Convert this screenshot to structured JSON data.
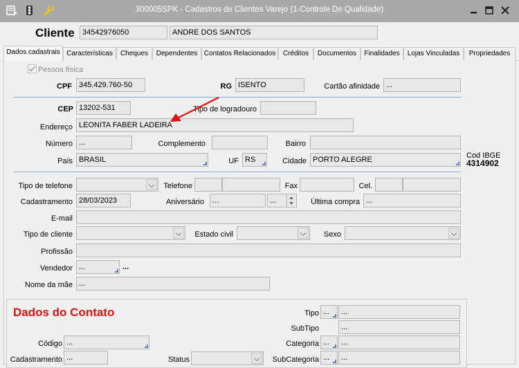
{
  "window": {
    "title": "300005SPK - Cadastros de Clientes Varejo (1-Controle De Qualidade)",
    "icons": [
      "menu-icon",
      "traffic-light-icon",
      "wrench-icon"
    ],
    "controls": [
      "minimize-icon",
      "restore-icon",
      "close-icon"
    ]
  },
  "header": {
    "label": "Cliente",
    "code": "34542976050",
    "name": "ANDRE DOS SANTOS"
  },
  "tabs": [
    {
      "label": "Dados cadastrais",
      "active": true
    },
    {
      "label": "Características"
    },
    {
      "label": "Cheques"
    },
    {
      "label": "Dependentes"
    },
    {
      "label": "Contatos Relacionados"
    },
    {
      "label": "Créditos"
    },
    {
      "label": "Documentos"
    },
    {
      "label": "Finalidades"
    },
    {
      "label": "Lojas Vinculadas"
    },
    {
      "label": "Propriedades"
    }
  ],
  "form": {
    "pessoa_fisica": {
      "label": "Pessoa física",
      "checked": true
    },
    "cpf": {
      "label": "CPF",
      "value": "345.429.760-50"
    },
    "rg": {
      "label": "RG",
      "value": "ISENTO"
    },
    "cartao_afinidade": {
      "label": "Cartão afinidade",
      "value": "..."
    },
    "cep": {
      "label": "CEP",
      "value": "13202-531"
    },
    "tipo_logradouro": {
      "label": "Tipo de logradouro",
      "value": ""
    },
    "endereco": {
      "label": "Endereço",
      "value": "LEONITA FABER LADEIRA"
    },
    "numero": {
      "label": "Número",
      "value": "..."
    },
    "complemento": {
      "label": "Complemento",
      "value": ""
    },
    "bairro": {
      "label": "Bairro",
      "value": ""
    },
    "pais": {
      "label": "País",
      "value": "BRASIL"
    },
    "uf": {
      "label": "UF",
      "value": "RS"
    },
    "cidade": {
      "label": "Cidade",
      "value": "PORTO ALEGRE"
    },
    "cod_ibge": {
      "label": "Cod IBGE",
      "value": "4314902"
    },
    "tipo_telefone": {
      "label": "Tipo de telefone",
      "value": ""
    },
    "telefone": {
      "label": "Telefone",
      "value": ""
    },
    "fax": {
      "label": "Fax",
      "value": ""
    },
    "cel": {
      "label": "Cel.",
      "value": ""
    },
    "cadastramento": {
      "label": "Cadastramento",
      "value": "28/03/2023"
    },
    "aniversario": {
      "label": "Aniversário",
      "value": "...",
      "value2": "..."
    },
    "ultima_compra": {
      "label": "Última compra",
      "value": "..."
    },
    "email": {
      "label": "E-mail",
      "value": ""
    },
    "tipo_cliente": {
      "label": "Tipo de cliente",
      "value": ""
    },
    "estado_civil": {
      "label": "Estado civil",
      "value": ""
    },
    "sexo": {
      "label": "Sexo",
      "value": ""
    },
    "profissao": {
      "label": "Profissão",
      "value": ""
    },
    "vendedor": {
      "label": "Vendedor",
      "value": "...",
      "extra": "..."
    },
    "nome_mae": {
      "label": "Nome da mãe",
      "value": "..."
    }
  },
  "contato": {
    "title": "Dados do Contato",
    "codigo": {
      "label": "Código",
      "value": "..."
    },
    "cadastramento": {
      "label": "Cadastramento",
      "value": "..."
    },
    "status": {
      "label": "Status",
      "value": ""
    },
    "tipo": {
      "label": "Tipo",
      "code": "...",
      "value": "..."
    },
    "subtipo": {
      "label": "SubTipo",
      "value": "..."
    },
    "categoria": {
      "label": "Categoria",
      "code": "...",
      "value": "..."
    },
    "subcategoria": {
      "label": "SubCategoria",
      "code": "...",
      "value": "..."
    }
  },
  "colors": {
    "titlebar": "#a9a9a9",
    "accent_red": "#e01010",
    "separator": "#7fb0dc"
  }
}
